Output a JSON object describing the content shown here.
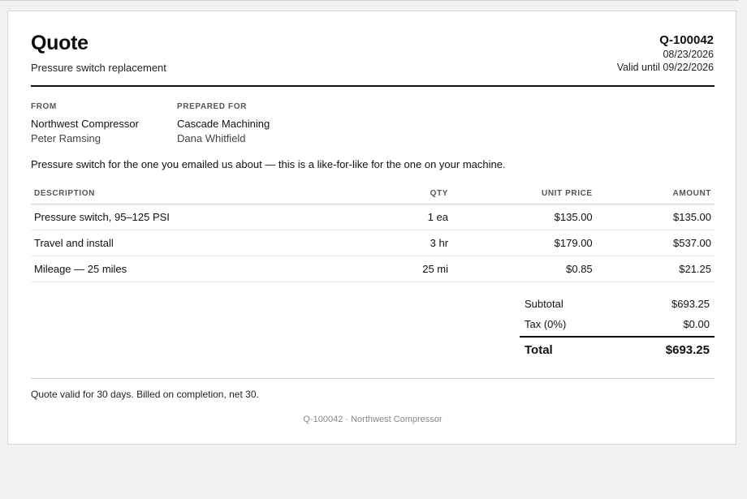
{
  "quote": {
    "title": "Quote",
    "subtitle": "Pressure switch replacement",
    "number": "Q-100042",
    "date": "08/23/2026",
    "valid_until": "Valid until 09/22/2026"
  },
  "from": {
    "label": "FROM",
    "org": "Northwest Compressor",
    "person": "Peter Ramsing"
  },
  "prepared_for": {
    "label": "PREPARED FOR",
    "org": "Cascade Machining",
    "person": "Dana Whitfield"
  },
  "note": "Pressure switch for the one you emailed us about — this is a like-for-like for the one on your machine.",
  "table": {
    "headers": {
      "description": "DESCRIPTION",
      "qty": "QTY",
      "unit_price": "UNIT PRICE",
      "amount": "AMOUNT"
    },
    "rows": [
      {
        "description": "Pressure switch, 95–125 PSI",
        "qty": "1 ea",
        "unit_price": "$135.00",
        "amount": "$135.00"
      },
      {
        "description": "Travel and install",
        "qty": "3 hr",
        "unit_price": "$179.00",
        "amount": "$537.00"
      },
      {
        "description": "Mileage — 25 miles",
        "qty": "25 mi",
        "unit_price": "$0.85",
        "amount": "$21.25"
      }
    ]
  },
  "totals": {
    "subtotal_label": "Subtotal",
    "subtotal": "$693.25",
    "tax_label": "Tax (0%)",
    "tax": "$0.00",
    "total_label": "Total",
    "total": "$693.25"
  },
  "terms": "Quote valid for 30 days. Billed on completion, net 30.",
  "footer": "Q-100042 · Northwest Compressor"
}
